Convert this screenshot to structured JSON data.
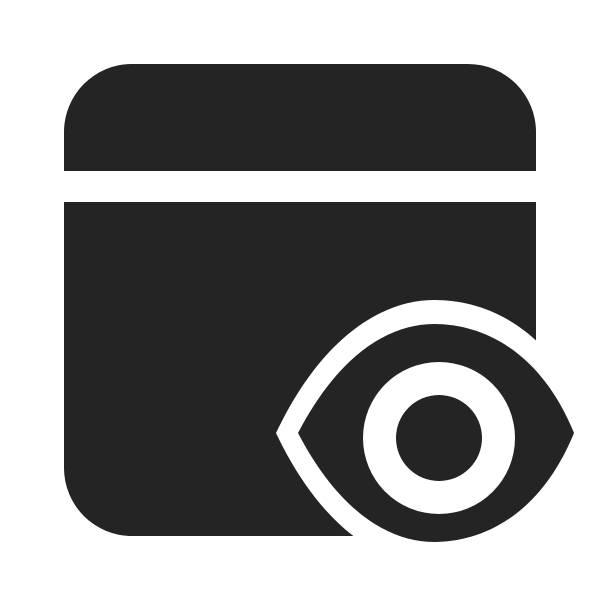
{
  "icon": {
    "name": "window-eye-icon",
    "parts": [
      "window-icon",
      "eye-icon"
    ],
    "colors": {
      "foreground": "#242424",
      "background": "#ffffff"
    }
  }
}
